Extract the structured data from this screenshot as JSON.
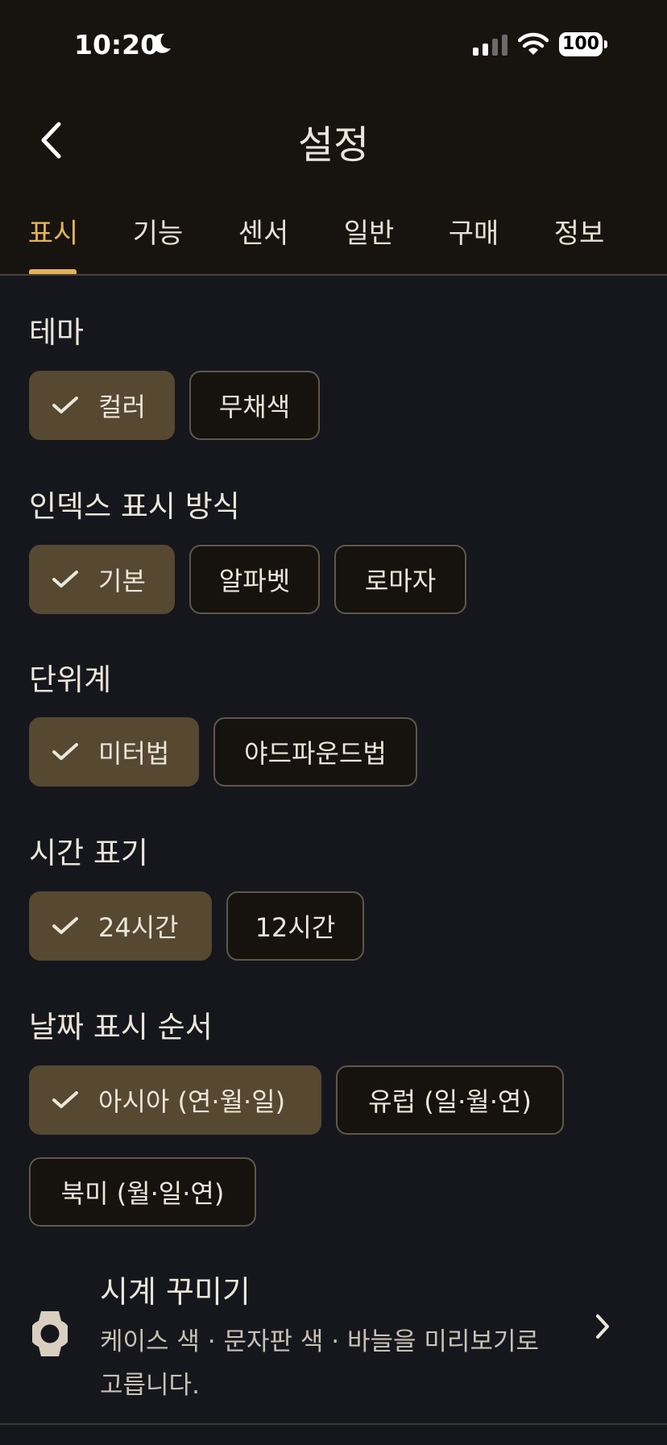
{
  "status_bar": {
    "time": "10:20",
    "battery": "100"
  },
  "header": {
    "title": "설정"
  },
  "tabs": [
    {
      "label": "표시",
      "active": true
    },
    {
      "label": "기능"
    },
    {
      "label": "센서"
    },
    {
      "label": "일반"
    },
    {
      "label": "구매"
    },
    {
      "label": "정보"
    }
  ],
  "sections": {
    "theme": {
      "label": "테마",
      "options": [
        "컬러",
        "무채색"
      ],
      "selected": "컬러"
    },
    "index_display": {
      "label": "인덱스 표시 방식",
      "options": [
        "기본",
        "알파벳",
        "로마자"
      ],
      "selected": "기본"
    },
    "units": {
      "label": "단위계",
      "options": [
        "미터법",
        "야드파운드법"
      ],
      "selected": "미터법"
    },
    "time_format": {
      "label": "시간 표기",
      "options": [
        "24시간",
        "12시간"
      ],
      "selected": "24시간"
    },
    "date_order": {
      "label": "날짜 표시 순서",
      "options": [
        "아시아 (연·월·일)",
        "유럽 (일·월·연)",
        "북미 (월·일·연)"
      ],
      "selected": "아시아 (연·월·일)"
    }
  },
  "watch_customize": {
    "title": "시계 꾸미기",
    "description": "케이스 색 · 문자판 색 · 바늘을 미리보기로 고릅니다."
  },
  "colors": {
    "accent": "#e3b35a",
    "selected_chip": "#564831",
    "background": "#15171c",
    "header_bg": "#17130e"
  },
  "icons": [
    "moon-icon",
    "signal-icon",
    "wifi-icon",
    "battery-icon",
    "back-chevron-icon",
    "check-icon",
    "watch-icon",
    "chevron-right-icon"
  ]
}
